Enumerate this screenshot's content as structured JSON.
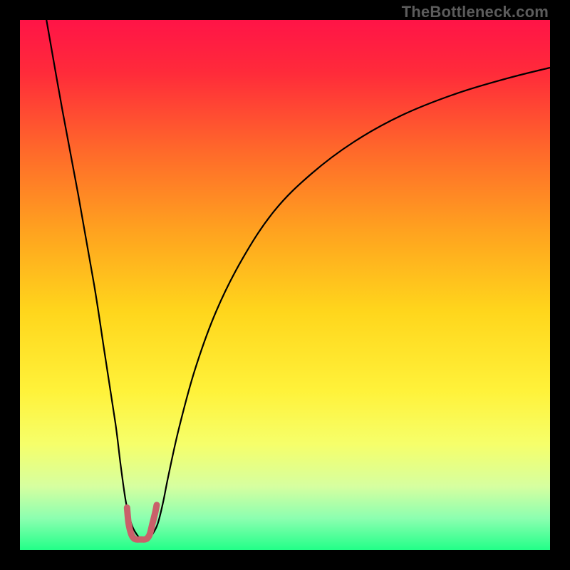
{
  "watermark": "TheBottleneck.com",
  "chart_data": {
    "type": "line",
    "title": "",
    "xlabel": "",
    "ylabel": "",
    "xlim": [
      0,
      100
    ],
    "ylim": [
      0,
      100
    ],
    "grid": false,
    "legend": false,
    "gradient_stops": [
      {
        "offset": 0.0,
        "color": "#ff1447"
      },
      {
        "offset": 0.1,
        "color": "#ff2b3a"
      },
      {
        "offset": 0.25,
        "color": "#ff6a2a"
      },
      {
        "offset": 0.4,
        "color": "#ffa31f"
      },
      {
        "offset": 0.55,
        "color": "#ffd61c"
      },
      {
        "offset": 0.7,
        "color": "#fff23a"
      },
      {
        "offset": 0.8,
        "color": "#f6ff6a"
      },
      {
        "offset": 0.88,
        "color": "#d6ffa0"
      },
      {
        "offset": 0.94,
        "color": "#8cffb0"
      },
      {
        "offset": 1.0,
        "color": "#22ff88"
      }
    ],
    "series": [
      {
        "name": "bottleneck-curve",
        "color": "#000000",
        "width": 2.2,
        "x": [
          5,
          8,
          11,
          14,
          16,
          18,
          19,
          20,
          21,
          22,
          23,
          24,
          25,
          26,
          27,
          28,
          30,
          33,
          37,
          42,
          48,
          55,
          63,
          72,
          82,
          92,
          100
        ],
        "y": [
          100,
          83,
          67,
          50,
          37,
          24,
          16,
          9,
          5,
          3,
          2,
          2,
          3,
          5,
          9,
          14,
          23,
          34,
          45,
          55,
          64,
          71,
          77,
          82,
          86,
          89,
          91
        ]
      },
      {
        "name": "optimal-range-marker",
        "color": "#c9606a",
        "width": 9,
        "linecap": "round",
        "x": [
          20.2,
          20.5,
          21.0,
          21.5,
          22.0,
          22.5,
          23.0,
          23.5,
          24.0,
          24.5,
          25.0,
          25.5,
          25.8
        ],
        "y": [
          8.0,
          5.0,
          3.0,
          2.2,
          2.0,
          2.0,
          2.0,
          2.0,
          2.2,
          3.0,
          5.0,
          7.0,
          8.5
        ]
      }
    ],
    "annotations": []
  }
}
